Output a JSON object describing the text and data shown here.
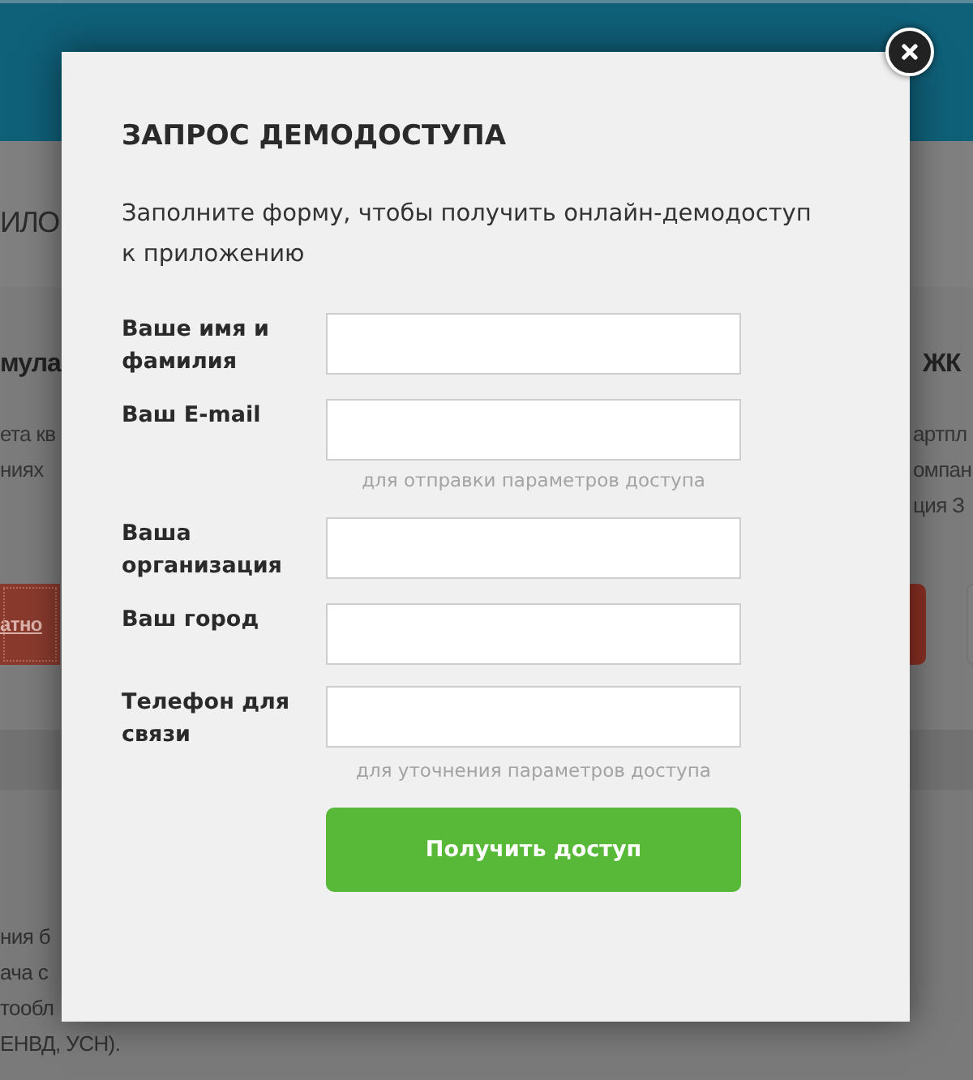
{
  "background_page": {
    "section_heading": "ИЛО",
    "left_card": {
      "title": "мула",
      "lines": [
        "ета кв",
        "ниях"
      ],
      "button": "атно"
    },
    "right_card": {
      "title": "ЖК",
      "lines": [
        "артпл",
        "омпан",
        "ция З"
      ]
    },
    "bottom_text": [
      "ния б",
      "ача с",
      "тообл",
      "ЕНВД, УСН)."
    ]
  },
  "dialog": {
    "title": "ЗАПРОС ДЕМОДОСТУПА",
    "description": "Заполните форму, чтобы получить онлайн-демодоступ к приложению",
    "fields": [
      {
        "label": "Ваше имя и фамилия"
      },
      {
        "label": "Ваш E-mail",
        "hint": "для отправки параметров доступа"
      },
      {
        "label": "Ваша организация"
      },
      {
        "label": "Ваш город"
      },
      {
        "label": "Телефон для связи",
        "hint": "для уточнения параметров доступа"
      }
    ],
    "submit": "Получить доступ"
  }
}
